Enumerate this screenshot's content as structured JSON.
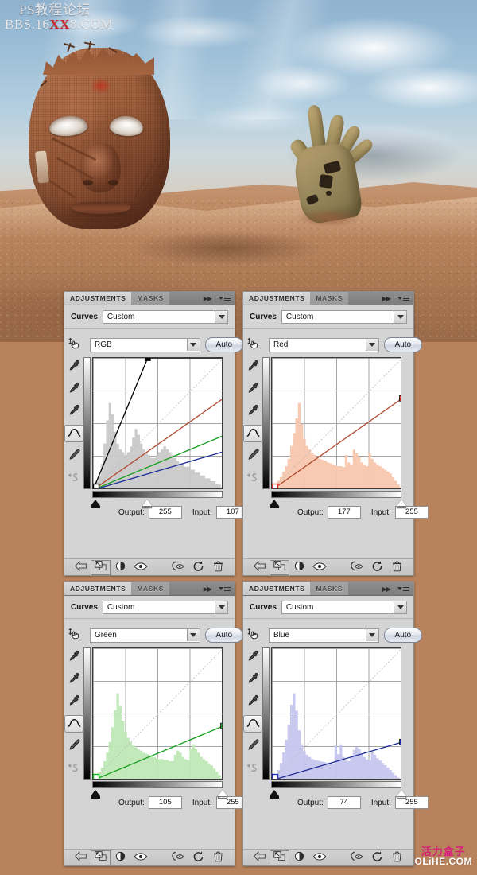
{
  "image": {
    "alt_description": "Surreal desert photomontage: a large stitched burlap face half-buried in sand and a weathered hand rising from a dune under a cloudy blue sky",
    "watermark_top": {
      "line1": "PS教程论坛",
      "line2_prefix": "BBS.16",
      "line2_highlight": "XX",
      "line2_suffix": "8.COM",
      "highlight_color": "#c62828"
    }
  },
  "watermark_bottom": {
    "chinese": "活力盒子",
    "english": "OLiHE.COM",
    "chinese_color": "#d6207a"
  },
  "panels": [
    {
      "id": "rgb",
      "tabs": {
        "active": "ADJUSTMENTS",
        "inactive": "MASKS"
      },
      "preset": {
        "label": "Curves",
        "value": "Custom"
      },
      "channel": {
        "value": "RGB",
        "auto_label": "Auto"
      },
      "output": {
        "label": "Output:",
        "value": "255"
      },
      "input": {
        "label": "Input:",
        "value": "107"
      },
      "curve_color": "#000000",
      "point_color": "#000000",
      "chart_data": {
        "type": "line",
        "title": "Curves — RGB composite",
        "xlabel": "Input",
        "ylabel": "Output",
        "xlim": [
          0,
          255
        ],
        "ylim": [
          0,
          255
        ],
        "grid": true,
        "series": [
          {
            "name": "RGB",
            "color": "#000000",
            "points": [
              [
                0,
                0
              ],
              [
                107,
                255
              ],
              [
                255,
                255
              ]
            ]
          },
          {
            "name": "Red",
            "color": "#b04a32",
            "points": [
              [
                0,
                0
              ],
              [
                255,
                177
              ]
            ]
          },
          {
            "name": "Green",
            "color": "#17a01f",
            "points": [
              [
                0,
                0
              ],
              [
                255,
                105
              ]
            ]
          },
          {
            "name": "Blue",
            "color": "#1f2e96",
            "points": [
              [
                0,
                0
              ],
              [
                255,
                74
              ]
            ]
          },
          {
            "name": "Baseline",
            "color": "#b9b9b9",
            "points": [
              [
                0,
                0
              ],
              [
                255,
                255
              ]
            ]
          }
        ],
        "histogram": {
          "color": "#c9c9c9",
          "values": [
            2,
            3,
            5,
            9,
            16,
            24,
            30,
            26,
            20,
            16,
            14,
            13,
            12,
            13,
            15,
            18,
            21,
            19,
            16,
            14,
            13,
            12,
            11,
            11,
            12,
            13,
            14,
            15,
            14,
            13,
            12,
            11,
            10,
            9,
            9,
            8,
            8,
            7,
            7,
            6,
            6,
            5,
            5,
            4,
            4,
            3,
            3,
            2,
            2,
            1
          ]
        },
        "black_point": 0,
        "white_point": 107
      }
    },
    {
      "id": "red",
      "tabs": {
        "active": "ADJUSTMENTS",
        "inactive": "MASKS"
      },
      "preset": {
        "label": "Curves",
        "value": "Custom"
      },
      "channel": {
        "value": "Red",
        "auto_label": "Auto"
      },
      "output": {
        "label": "Output:",
        "value": "177"
      },
      "input": {
        "label": "Input:",
        "value": "255"
      },
      "curve_color": "#b04a32",
      "point_color": "#e03020",
      "chart_data": {
        "type": "line",
        "title": "Curves — Red channel",
        "xlabel": "Input",
        "ylabel": "Output",
        "xlim": [
          0,
          255
        ],
        "ylim": [
          0,
          255
        ],
        "grid": true,
        "series": [
          {
            "name": "Red",
            "color": "#b04a32",
            "points": [
              [
                0,
                0
              ],
              [
                255,
                177
              ]
            ]
          },
          {
            "name": "Baseline",
            "color": "#b9b9b9",
            "points": [
              [
                0,
                0
              ],
              [
                255,
                255
              ]
            ]
          }
        ],
        "histogram": {
          "color": "#f8c7ad",
          "values": [
            4,
            6,
            10,
            14,
            20,
            26,
            34,
            48,
            62,
            78,
            95,
            72,
            56,
            48,
            44,
            40,
            38,
            36,
            34,
            33,
            32,
            30,
            29,
            28,
            27,
            26,
            26,
            25,
            38,
            30,
            28,
            44,
            40,
            36,
            30,
            28,
            26,
            40,
            34,
            30,
            28,
            26,
            24,
            22,
            20,
            18,
            14,
            10,
            6,
            3
          ]
        },
        "black_point": 0,
        "white_point": 255
      }
    },
    {
      "id": "green",
      "tabs": {
        "active": "ADJUSTMENTS",
        "inactive": "MASKS"
      },
      "preset": {
        "label": "Curves",
        "value": "Custom"
      },
      "channel": {
        "value": "Green",
        "auto_label": "Auto"
      },
      "output": {
        "label": "Output:",
        "value": "105"
      },
      "input": {
        "label": "Input:",
        "value": "255"
      },
      "curve_color": "#17a01f",
      "point_color": "#14b020",
      "chart_data": {
        "type": "line",
        "title": "Curves — Green channel",
        "xlabel": "Input",
        "ylabel": "Output",
        "xlim": [
          0,
          255
        ],
        "ylim": [
          0,
          255
        ],
        "grid": true,
        "series": [
          {
            "name": "Green",
            "color": "#17a01f",
            "points": [
              [
                0,
                0
              ],
              [
                255,
                105
              ]
            ]
          },
          {
            "name": "Baseline",
            "color": "#b9b9b9",
            "points": [
              [
                0,
                0
              ],
              [
                255,
                255
              ]
            ]
          }
        ],
        "histogram": {
          "color": "#bfe8b6",
          "values": [
            3,
            5,
            8,
            12,
            18,
            26,
            36,
            50,
            66,
            82,
            70,
            56,
            46,
            40,
            36,
            33,
            31,
            29,
            28,
            26,
            25,
            24,
            23,
            22,
            21,
            20,
            20,
            19,
            19,
            18,
            18,
            24,
            28,
            26,
            22,
            20,
            19,
            30,
            34,
            30,
            26,
            22,
            20,
            18,
            16,
            14,
            11,
            8,
            5,
            2
          ]
        },
        "black_point": 0,
        "white_point": 255
      }
    },
    {
      "id": "blue",
      "tabs": {
        "active": "ADJUSTMENTS",
        "inactive": "MASKS"
      },
      "preset": {
        "label": "Curves",
        "value": "Custom"
      },
      "channel": {
        "value": "Blue",
        "auto_label": "Auto"
      },
      "output": {
        "label": "Output:",
        "value": "74"
      },
      "input": {
        "label": "Input:",
        "value": "255"
      },
      "curve_color": "#1f2e96",
      "point_color": "#2030c0",
      "chart_data": {
        "type": "line",
        "title": "Curves — Blue channel",
        "xlabel": "Input",
        "ylabel": "Output",
        "xlim": [
          0,
          255
        ],
        "ylim": [
          0,
          255
        ],
        "grid": true,
        "series": [
          {
            "name": "Blue",
            "color": "#1f2e96",
            "points": [
              [
                0,
                0
              ],
              [
                255,
                74
              ]
            ]
          },
          {
            "name": "Baseline",
            "color": "#b9b9b9",
            "points": [
              [
                0,
                0
              ],
              [
                255,
                255
              ]
            ]
          }
        ],
        "histogram": {
          "color": "#c6c6ee",
          "values": [
            6,
            10,
            18,
            30,
            48,
            70,
            96,
            130,
            150,
            120,
            86,
            62,
            50,
            44,
            40,
            37,
            35,
            34,
            33,
            32,
            31,
            30,
            30,
            29,
            60,
            45,
            62,
            40,
            34,
            33,
            40,
            52,
            58,
            54,
            46,
            40,
            36,
            34,
            48,
            44,
            38,
            34,
            30,
            26,
            22,
            18,
            13,
            9,
            5,
            2
          ]
        },
        "black_point": 0,
        "white_point": 255
      }
    }
  ],
  "tool_column": {
    "items": [
      {
        "name": "targeted-adjustment",
        "glyph": "hand"
      },
      {
        "name": "black-point-eyedropper",
        "glyph": "dropper"
      },
      {
        "name": "gray-point-eyedropper",
        "glyph": "dropper"
      },
      {
        "name": "white-point-eyedropper",
        "glyph": "dropper"
      },
      {
        "name": "curve-tool",
        "glyph": "curve",
        "selected": true
      },
      {
        "name": "pencil-tool",
        "glyph": "pencil"
      },
      {
        "name": "smooth-curve",
        "glyph": "smooth"
      }
    ]
  },
  "footer": {
    "items": [
      {
        "name": "return-to-adjustment-list",
        "glyph": "back-arrow"
      },
      {
        "name": "clip-to-layer",
        "glyph": "clip"
      },
      {
        "name": "new-adjustment-layer",
        "glyph": "half-circle"
      },
      {
        "name": "toggle-layer-visibility",
        "glyph": "eye"
      },
      {
        "name": "preview-previous-state",
        "glyph": "preview-eye"
      },
      {
        "name": "reset-adjustment",
        "glyph": "reset"
      },
      {
        "name": "delete-adjustment-layer",
        "glyph": "trash"
      }
    ]
  }
}
